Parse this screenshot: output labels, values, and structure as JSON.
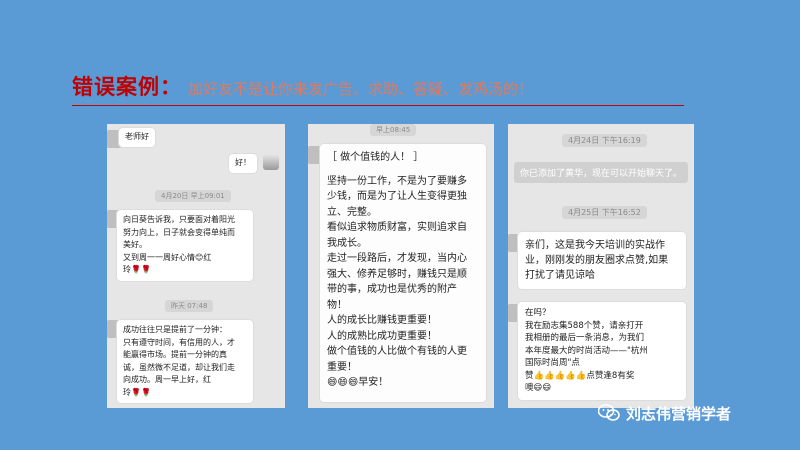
{
  "title": {
    "main": "错误案例：",
    "sub": "加好友不是让你来发广告、求助、答疑、发鸡汤的！"
  },
  "panel1": {
    "msg1": "老师好",
    "msg2": "好！",
    "ts1": "4月20日 早上09:01",
    "bubble3_lines": [
      "向日葵告诉我，只要面对着阳光",
      "努力向上，日子就会变得单纯而",
      "美好。",
      "又到周一一周好心情😊红",
      "玲🌹🌹"
    ],
    "ts2": "昨天 07:48",
    "bubble4_lines": [
      "成功往往只是提前了一分钟：",
      "只有遵守时间，有信用的人，才",
      "能赢得市场。提前一分钟的真",
      "诚，虽然微不足道，却让我们走",
      "向成功。周一早上好，红",
      "玲🌹🌹"
    ]
  },
  "panel2": {
    "ts": "早上08:45",
    "lines": [
      "［ 做个值钱的人！ ］",
      "",
      "坚持一份工作，不是为了要赚多",
      "少钱，而是为了让人生变得更独",
      "立、完整。",
      "看似追求物质财富，实则追求自",
      "我成长。",
      "走过一段路后，才发现，当内心",
      "强大、修养足够时，赚钱只是顺",
      "带的事，成功也是优秀的附产",
      "物！",
      " 人的成长比赚钱更重要！",
      " 人的成熟比成功更重要！",
      " 做个值钱的人比做个有钱的人更",
      " 重要！",
      "😄😄😄早安！"
    ]
  },
  "panel3": {
    "ts1": "4月24日 下午16:19",
    "sys": "你已添加了黄华，现在可以开始聊天了。",
    "ts2": "4月25日 下午16:52",
    "bubble1_lines": [
      "亲们，这是我今天培训的实战作",
      "业，刚刚发的朋友圈求点赞,如果",
      "打扰了请见谅哈"
    ],
    "bubble2_lines": [
      "在吗？",
      "我在励志集588个赞，请亲打开",
      "我相册的最后一条消息，为我们",
      "本年度最大的时尚活动——\"杭州",
      "国际时尚周\"点",
      "赞👍👍👍👍👍点赞逢8有奖",
      "噢😄😄"
    ]
  },
  "watermark": "刘志伟营销学者",
  "colors": {
    "background": "#5b9bd5",
    "title_red": "#c00000",
    "subtitle_orange": "#e07a5f"
  }
}
